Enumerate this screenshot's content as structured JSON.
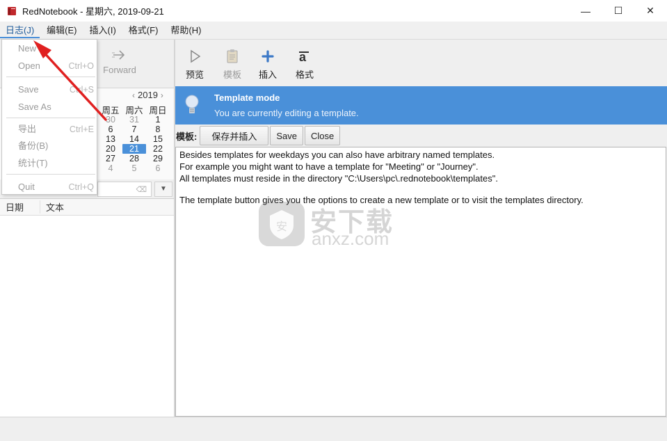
{
  "window": {
    "title": "RedNotebook - 星期六, 2019-09-21",
    "min_glyph": "—",
    "max_glyph": "☐",
    "close_glyph": "✕"
  },
  "menubar": {
    "items": [
      "日志(J)",
      "编辑(E)",
      "插入(I)",
      "格式(F)",
      "帮助(H)"
    ]
  },
  "journal_menu": {
    "items": [
      {
        "label": "New",
        "shortcut": ""
      },
      {
        "label": "Open",
        "shortcut": "Ctrl+O"
      },
      {
        "label": "Save",
        "shortcut": "Ctrl+S"
      },
      {
        "label": "Save As",
        "shortcut": ""
      },
      {
        "label": "导出",
        "shortcut": "Ctrl+E"
      },
      {
        "label": "备份(B)",
        "shortcut": ""
      },
      {
        "label": "统计(T)",
        "shortcut": ""
      },
      {
        "label": "Quit",
        "shortcut": "Ctrl+Q"
      }
    ]
  },
  "nav": {
    "forward_label": "Forward"
  },
  "calendar": {
    "year": "2019",
    "prev": "‹",
    "next": "›",
    "dow": [
      "周五",
      "周六",
      "周日"
    ],
    "rows": [
      [
        "30",
        "31",
        "1"
      ],
      [
        "6",
        "7",
        "8"
      ],
      [
        "13",
        "14",
        "15"
      ],
      [
        "20",
        "21",
        "22"
      ],
      [
        "27",
        "28",
        "29"
      ],
      [
        "4",
        "5",
        "6"
      ]
    ],
    "selected": "21"
  },
  "search": {
    "clear_glyph": "⌫",
    "dropdown_glyph": "▼"
  },
  "list": {
    "col_date": "日期",
    "col_text": "文本"
  },
  "toolbar": {
    "preview": "预览",
    "template": "模板",
    "insert": "插入",
    "format": "格式"
  },
  "info": {
    "title": "Template mode",
    "text": "You are currently editing a template."
  },
  "template_bar": {
    "label": "模板:",
    "save_insert": "保存并插入",
    "save": "Save",
    "close": "Close"
  },
  "editor": {
    "lines": [
      "Besides templates for weekdays you can also have arbitrary named templates.",
      "For example you might want to have a template for \"Meeting\" or \"Journey\".",
      "All templates must reside in the directory \"C:\\Users\\pc\\.rednotebook\\templates\".",
      "",
      "The template button gives you the options to create a new template or to visit the templates directory."
    ]
  },
  "watermark": {
    "cn": "安下载",
    "en": "anxz.com"
  },
  "colors": {
    "accent": "#4a90d9",
    "arrow": "#e02020"
  }
}
